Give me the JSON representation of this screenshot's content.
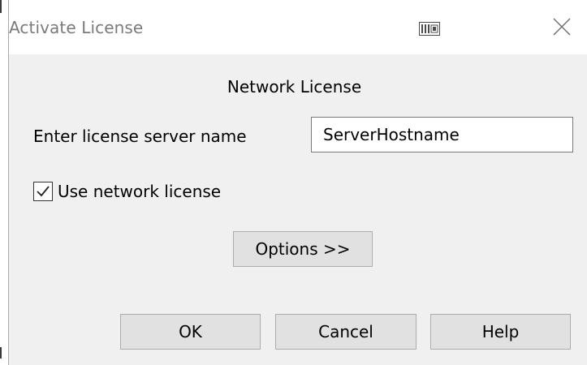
{
  "window": {
    "title": "Activate License",
    "title_icon": "license-window-icon",
    "close_icon": "close-icon"
  },
  "dialog": {
    "heading": "Network License",
    "server_label": "Enter license server name",
    "server_value": "ServerHostname",
    "use_network_license_label": "Use network license",
    "use_network_license_checked": true,
    "options_label": "Options >>"
  },
  "buttons": {
    "ok": "OK",
    "cancel": "Cancel",
    "help": "Help"
  },
  "colors": {
    "dialog_background": "#f0f0f0",
    "titlebar_background": "#ffffff",
    "button_background": "#e1e1e1",
    "button_border": "#adadad",
    "title_text": "#7a7a7a"
  }
}
